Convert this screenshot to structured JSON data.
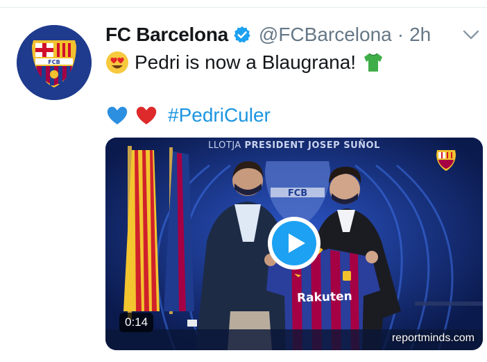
{
  "account": {
    "display_name": "FC Barcelona",
    "handle": "@FCBarcelona",
    "separator": "·",
    "timestamp": "2h",
    "avatar_icon": "fc-barcelona-crest-icon",
    "verified_icon": "verified-badge-icon",
    "avatar_text": "FCB"
  },
  "tweet": {
    "line1_text": "Pedri is now a Blaugrana!",
    "line1_leading_emoji": "heart-eyes-emoji",
    "line1_trailing_emoji": "green-shirt-emoji",
    "line2_emojis": [
      "blue-heart-emoji",
      "red-heart-emoji"
    ],
    "hashtag": "#PedriCuler"
  },
  "media": {
    "backdrop_text_prefix": "LLOTJA",
    "backdrop_text_main": "PRESIDENT JOSEP SUÑOL",
    "backdrop_crest_text": "FCB",
    "jersey_sponsor": "Rakuten",
    "duration": "0:14",
    "watermark": "reportminds.com",
    "play_icon": "play-icon"
  },
  "colors": {
    "link": "#1b95e0",
    "verified": "#1da1f2",
    "text": "#14171a",
    "muted": "#657786",
    "barca_blue": "#1f3b8e",
    "barca_red": "#a50044"
  }
}
